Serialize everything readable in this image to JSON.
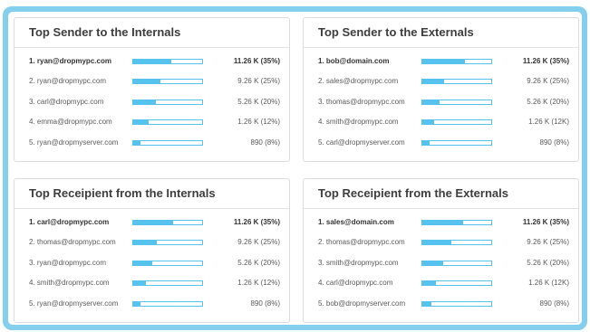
{
  "colors": {
    "frame": "#84cfee",
    "bar": "#56c3ee"
  },
  "panels": [
    {
      "title": "Top Sender to the Internals",
      "rows": [
        {
          "label": "1. ryan@dropmypc.com",
          "value": "11.26 K (35%)",
          "fraction": 0.55
        },
        {
          "label": "2. ryan@dropmypc.com",
          "value": "9.26 K (25%)",
          "fraction": 0.39
        },
        {
          "label": "3. carl@dropmypc.com",
          "value": "5.26 K (20%)",
          "fraction": 0.33
        },
        {
          "label": "4. emma@dropmypc.com",
          "value": "1.26 K (12%)",
          "fraction": 0.22
        },
        {
          "label": "5. ryan@dropmyserver.com",
          "value": "890 (8%)",
          "fraction": 0.11
        }
      ]
    },
    {
      "title": "Top Sender to the Externals",
      "rows": [
        {
          "label": "1. bob@domain.com",
          "value": "11.26 K (35%)",
          "fraction": 0.62
        },
        {
          "label": "2. sales@dropmypc.com",
          "value": "9.26 K (25%)",
          "fraction": 0.32
        },
        {
          "label": "3. thomas@dropmypc.com",
          "value": "5.26 K (20%)",
          "fraction": 0.25
        },
        {
          "label": "4. smith@dropmypc.com",
          "value": "1.26 K (12K)",
          "fraction": 0.17
        },
        {
          "label": "5. carl@dropmyserver.com",
          "value": "890 (8%)",
          "fraction": 0.11
        }
      ]
    },
    {
      "title": "Top Receipient from the Internals",
      "rows": [
        {
          "label": "1. carl@dropmypc.com",
          "value": "11.26 K (35%)",
          "fraction": 0.58
        },
        {
          "label": "2. thomas@dropmypc.com",
          "value": "9.26 K (25%)",
          "fraction": 0.34
        },
        {
          "label": "3. ryan@dropmypc.com",
          "value": "5.26 K (20%)",
          "fraction": 0.28
        },
        {
          "label": "4. smith@dropmypc.com",
          "value": "1.26 K (12%)",
          "fraction": 0.18
        },
        {
          "label": "5. ryan@dropmyserver.com",
          "value": "890 (8%)",
          "fraction": 0.1
        }
      ]
    },
    {
      "title": "Top Receipient from the Externals",
      "rows": [
        {
          "label": "1. sales@domain.com",
          "value": "11.26 K (35%)",
          "fraction": 0.59
        },
        {
          "label": "2. thomas@dropmypc.com",
          "value": "9.26 K (25%)",
          "fraction": 0.42
        },
        {
          "label": "3. smith@dropmypc.com",
          "value": "5.26 K (20%)",
          "fraction": 0.3
        },
        {
          "label": "4. carl@dropmypc.com",
          "value": "1.26 K (12K)",
          "fraction": 0.2
        },
        {
          "label": "5. bob@dropmyserver.com",
          "value": "890 (8%)",
          "fraction": 0.13
        }
      ]
    }
  ]
}
